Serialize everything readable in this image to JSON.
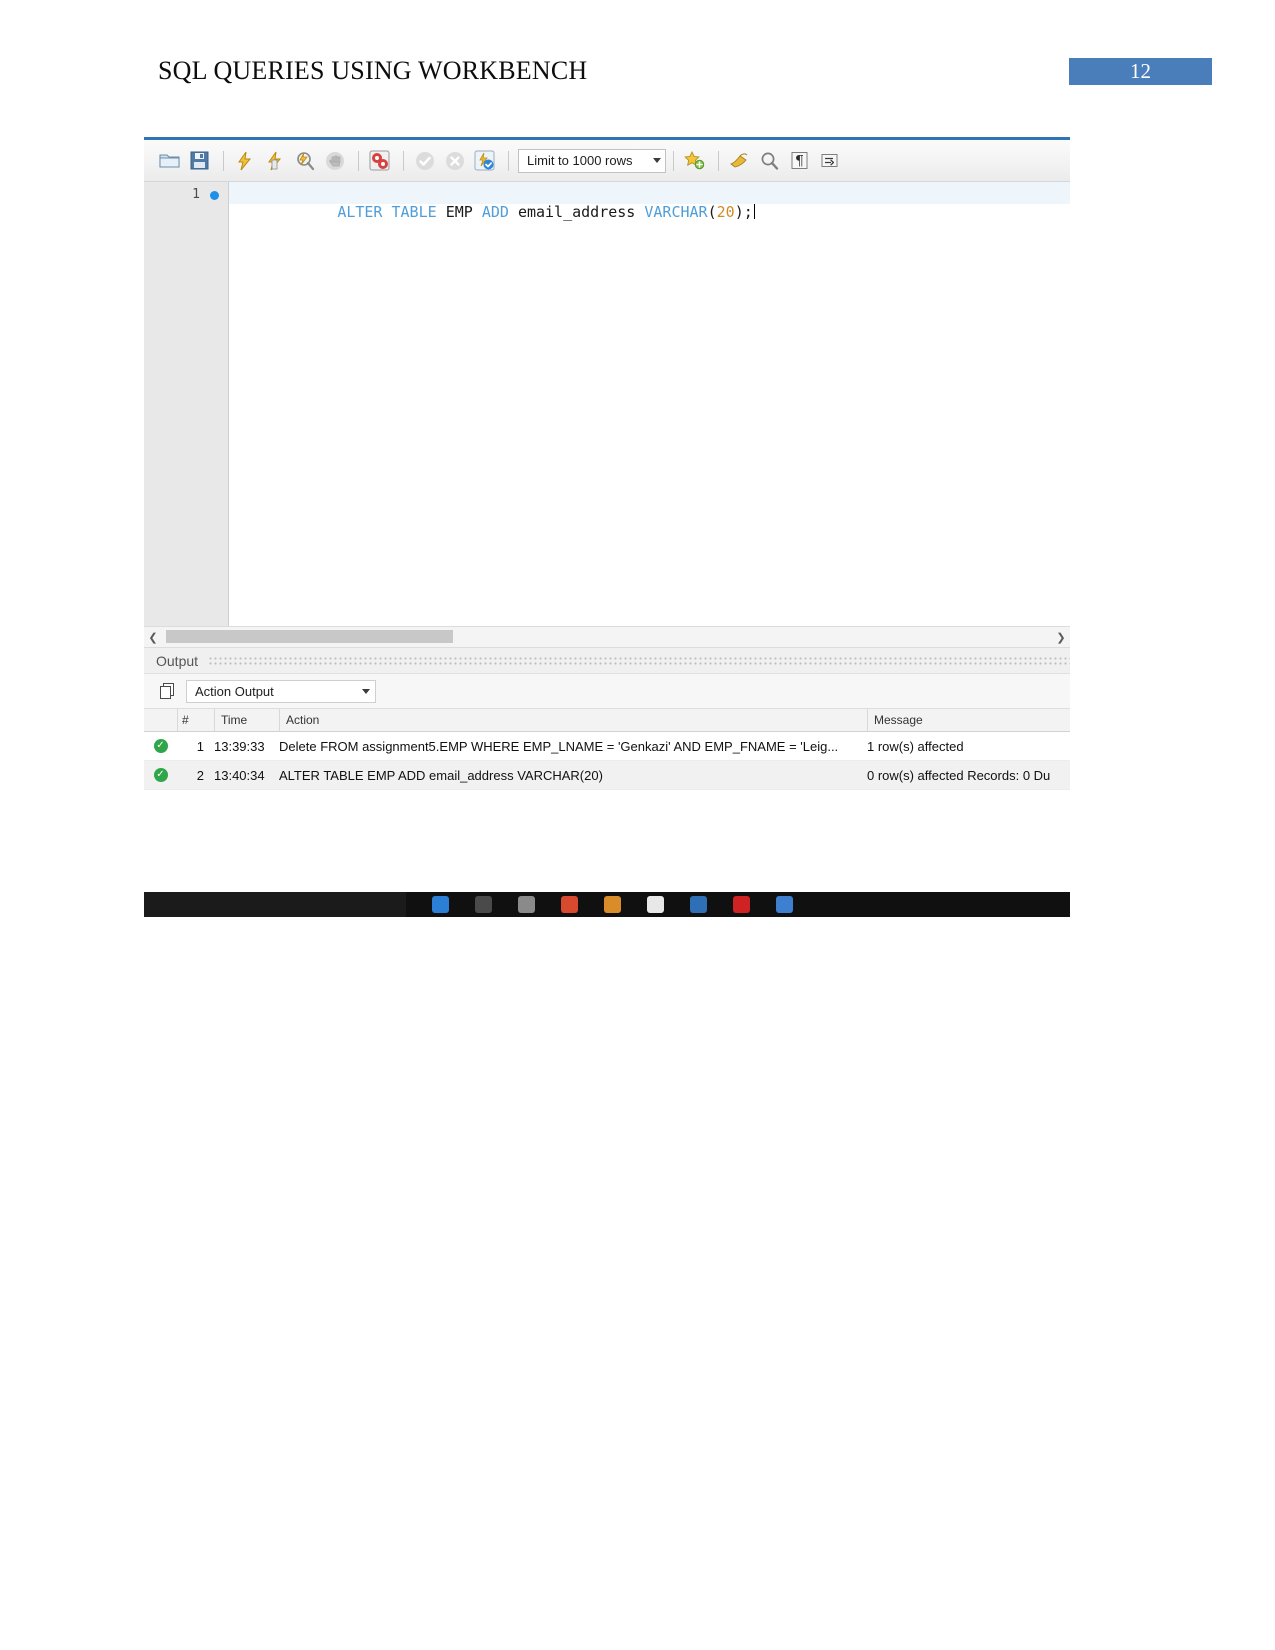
{
  "document": {
    "title": "SQL QUERIES USING WORKBENCH",
    "page_number": "12",
    "badge_color": "#4a7ebb"
  },
  "workbench": {
    "toolbar": {
      "buttons": [
        {
          "name": "open-sql-script-icon",
          "label": "Open SQL Script"
        },
        {
          "name": "save-script-icon",
          "label": "Save Script"
        },
        {
          "name": "execute-statement-icon",
          "label": "Execute"
        },
        {
          "name": "execute-current-statement-icon",
          "label": "Execute Current Statement"
        },
        {
          "name": "explain-query-icon",
          "label": "Explain Current Statement"
        },
        {
          "name": "stop-execution-icon",
          "label": "Stop"
        },
        {
          "name": "toggle-stop-on-error-icon",
          "label": "Toggle Stop On Error"
        },
        {
          "name": "commit-icon",
          "label": "Commit"
        },
        {
          "name": "rollback-icon",
          "label": "Rollback"
        },
        {
          "name": "toggle-autocommit-icon",
          "label": "Toggle Autocommit"
        }
      ],
      "limit_selector": {
        "value": "Limit to 1000 rows"
      },
      "right_buttons": [
        {
          "name": "save-snippet-icon",
          "label": "Save Snippet"
        },
        {
          "name": "beautify-query-icon",
          "label": "Beautify Query"
        },
        {
          "name": "find-icon",
          "label": "Find"
        },
        {
          "name": "toggle-invisible-characters-icon",
          "label": "Toggle Invisible Characters"
        },
        {
          "name": "toggle-word-wrap-icon",
          "label": "Toggle Word Wrap"
        }
      ]
    },
    "editor": {
      "line_number": "1",
      "sql_tokens": [
        {
          "text": "ALTER",
          "type": "keyword"
        },
        {
          "text": " ",
          "type": "plain"
        },
        {
          "text": "TABLE",
          "type": "keyword"
        },
        {
          "text": " ",
          "type": "plain"
        },
        {
          "text": "EMP",
          "type": "identifier"
        },
        {
          "text": " ",
          "type": "plain"
        },
        {
          "text": "ADD",
          "type": "keyword"
        },
        {
          "text": " ",
          "type": "plain"
        },
        {
          "text": "email_address",
          "type": "identifier"
        },
        {
          "text": " ",
          "type": "plain"
        },
        {
          "text": "VARCHAR",
          "type": "keyword"
        },
        {
          "text": "(",
          "type": "punct"
        },
        {
          "text": "20",
          "type": "number"
        },
        {
          "text": ");",
          "type": "punct"
        }
      ],
      "sql_plain": "ALTER TABLE EMP ADD email_address VARCHAR(20);"
    },
    "output_panel": {
      "title": "Output",
      "selector_value": "Action Output",
      "columns": [
        "#",
        "Time",
        "Action",
        "Message"
      ],
      "rows": [
        {
          "status": "success",
          "num": "1",
          "time": "13:39:33",
          "action": "Delete FROM assignment5.EMP WHERE EMP_LNAME = 'Genkazi' AND EMP_FNAME = 'Leig...",
          "message": "1 row(s) affected"
        },
        {
          "status": "success",
          "num": "2",
          "time": "13:40:34",
          "action": "ALTER TABLE EMP ADD email_address VARCHAR(20)",
          "message": "0 row(s) affected Records: 0  Du"
        }
      ]
    }
  }
}
